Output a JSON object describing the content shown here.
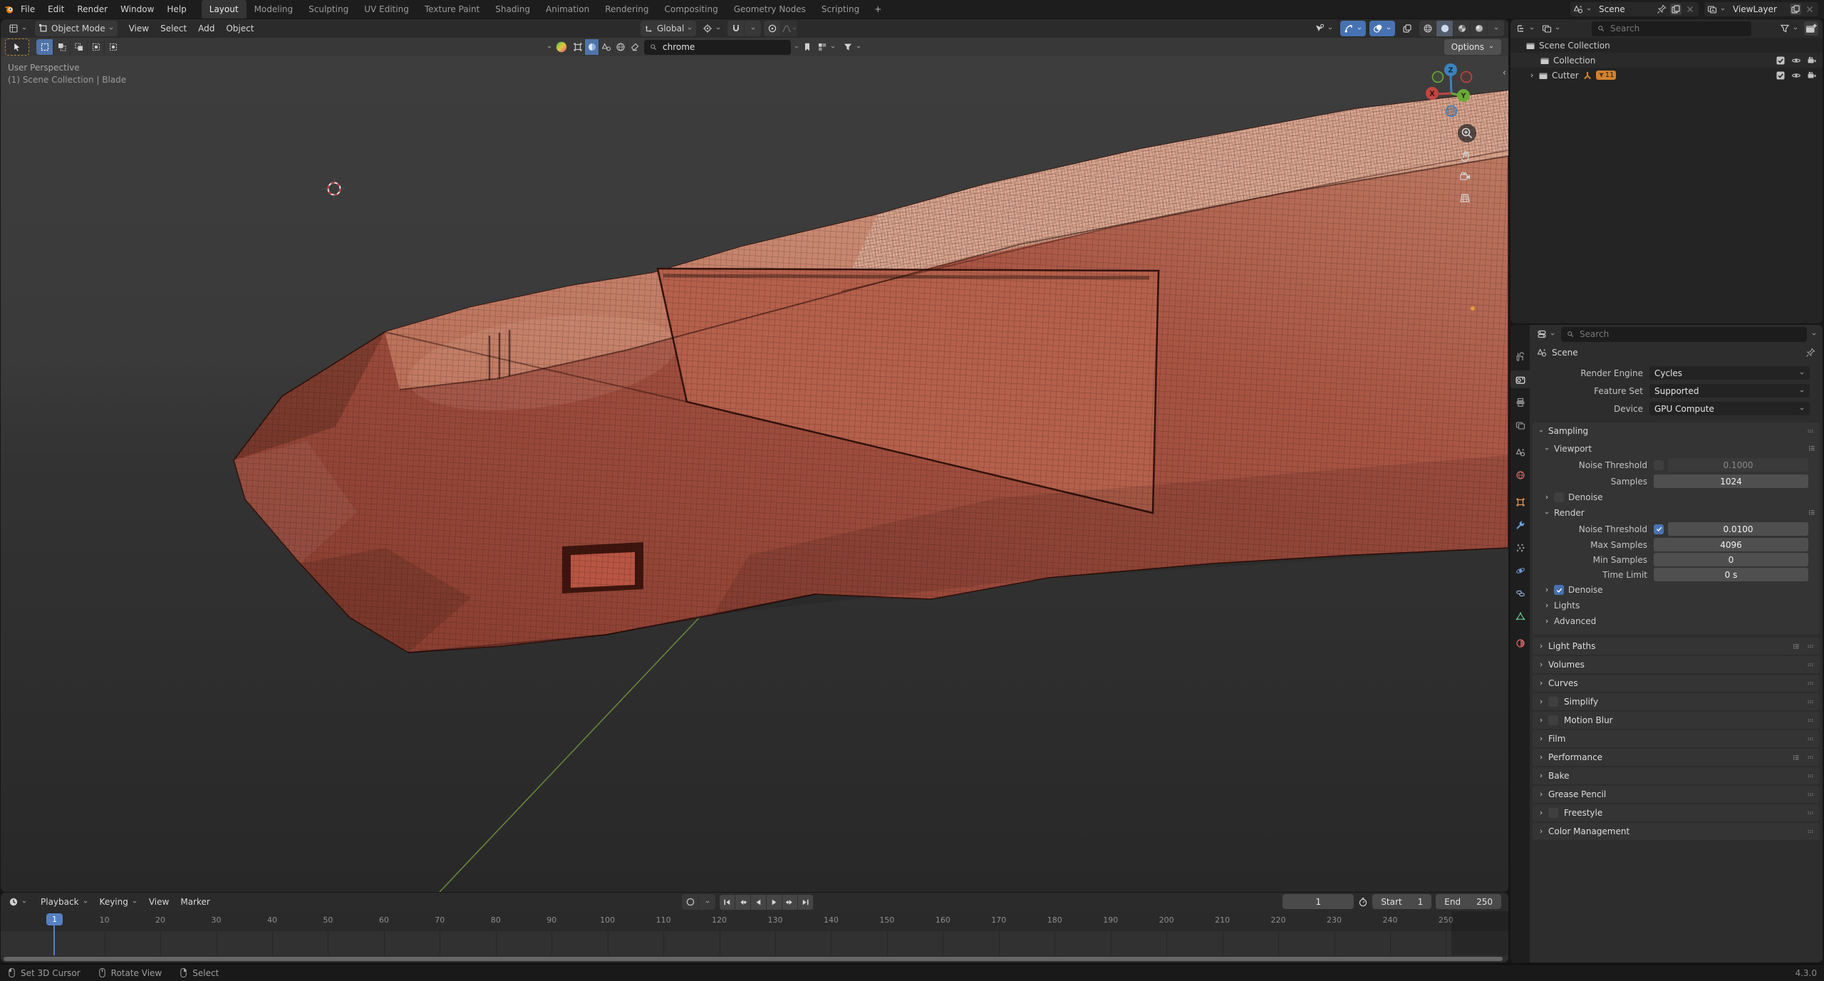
{
  "app": {
    "version": "4.3.0"
  },
  "topbar": {
    "menus": [
      "File",
      "Edit",
      "Render",
      "Window",
      "Help"
    ],
    "workspaces": [
      "Layout",
      "Modeling",
      "Sculpting",
      "UV Editing",
      "Texture Paint",
      "Shading",
      "Animation",
      "Rendering",
      "Compositing",
      "Geometry Nodes",
      "Scripting"
    ],
    "active_workspace": "Layout",
    "new_workspace_label": "+",
    "scene": {
      "value": "Scene"
    },
    "view_layer": {
      "value": "ViewLayer"
    }
  },
  "viewport": {
    "header": {
      "mode": "Object Mode",
      "menus": [
        "View",
        "Select",
        "Add",
        "Object"
      ],
      "orientation": "Global",
      "shading_active": "solid"
    },
    "tool_settings": {
      "search_value": "chrome",
      "options_label": "Options"
    },
    "overlay": {
      "line1": "User Perspective",
      "line2": "(1) Scene Collection | Blade"
    },
    "gizmo": {
      "x": "X",
      "y": "Y",
      "z": "Z"
    }
  },
  "outliner": {
    "search_placeholder": "Search",
    "rows": [
      {
        "label": "Scene Collection",
        "depth": 0,
        "expander": false,
        "toggles": false,
        "count": ""
      },
      {
        "label": "Collection",
        "depth": 1,
        "expander": false,
        "toggles": true,
        "count": ""
      },
      {
        "label": "Cutter",
        "depth": 1,
        "expander": true,
        "toggles": true,
        "count": "11"
      }
    ]
  },
  "properties": {
    "search_placeholder": "Search",
    "breadcrumb": "Scene",
    "tabs": [
      {
        "icon": "tool",
        "active": false,
        "group": 0
      },
      {
        "icon": "render",
        "active": true,
        "group": 0
      },
      {
        "icon": "output",
        "active": false,
        "group": 0
      },
      {
        "icon": "view-layer",
        "active": false,
        "group": 0
      },
      {
        "icon": "scene",
        "active": false,
        "group": 1
      },
      {
        "icon": "world",
        "active": false,
        "group": 0
      },
      {
        "icon": "object",
        "active": false,
        "group": 1
      },
      {
        "icon": "modifiers",
        "active": false,
        "group": 0
      },
      {
        "icon": "particles",
        "active": false,
        "group": 0
      },
      {
        "icon": "physics",
        "active": false,
        "group": 0
      },
      {
        "icon": "constraints",
        "active": false,
        "group": 0
      },
      {
        "icon": "object-data",
        "active": false,
        "group": 0
      },
      {
        "icon": "material",
        "active": false,
        "group": 1
      }
    ],
    "engine_fields": [
      {
        "label": "Render Engine",
        "value": "Cycles"
      },
      {
        "label": "Feature Set",
        "value": "Supported"
      },
      {
        "label": "Device",
        "value": "GPU Compute"
      }
    ],
    "sampling": {
      "title": "Sampling",
      "viewport": {
        "title": "Viewport",
        "noise_label": "Noise Threshold",
        "noise_value": "0.1000",
        "noise_enabled": false,
        "samples_label": "Samples",
        "samples_value": "1024",
        "denoise_label": "Denoise",
        "denoise_checked": false
      },
      "render": {
        "title": "Render",
        "noise_label": "Noise Threshold",
        "noise_value": "0.0100",
        "noise_enabled": true,
        "rows": [
          {
            "label": "Max Samples",
            "value": "4096"
          },
          {
            "label": "Min Samples",
            "value": "0"
          },
          {
            "label": "Time Limit",
            "value": "0 s"
          }
        ],
        "denoise_label": "Denoise",
        "denoise_checked": true
      },
      "extra_rows": [
        {
          "label": "Lights"
        },
        {
          "label": "Advanced"
        }
      ]
    },
    "panels": [
      {
        "title": "Light Paths",
        "menu": true,
        "checkbox": false
      },
      {
        "title": "Volumes",
        "menu": false,
        "checkbox": false
      },
      {
        "title": "Curves",
        "menu": false,
        "checkbox": false
      },
      {
        "title": "Simplify",
        "menu": false,
        "checkbox": true
      },
      {
        "title": "Motion Blur",
        "menu": false,
        "checkbox": true
      },
      {
        "title": "Film",
        "menu": false,
        "checkbox": false
      },
      {
        "title": "Performance",
        "menu": true,
        "checkbox": false
      },
      {
        "title": "Bake",
        "menu": false,
        "checkbox": false
      },
      {
        "title": "Grease Pencil",
        "menu": false,
        "checkbox": false
      },
      {
        "title": "Freestyle",
        "menu": false,
        "checkbox": true
      },
      {
        "title": "Color Management",
        "menu": false,
        "checkbox": false
      }
    ]
  },
  "timeline": {
    "menus": [
      {
        "label": "Playback",
        "caret": true
      },
      {
        "label": "Keying",
        "caret": true
      },
      {
        "label": "View",
        "caret": false
      },
      {
        "label": "Marker",
        "caret": false
      }
    ],
    "current_frame": "1",
    "start_label": "Start",
    "start_value": "1",
    "end_label": "End",
    "end_value": "250",
    "ruler_ticks": [
      10,
      20,
      30,
      40,
      50,
      60,
      70,
      80,
      90,
      100,
      110,
      120,
      130,
      140,
      150,
      160,
      170,
      180,
      190,
      200,
      210,
      220,
      230,
      240,
      250
    ],
    "playhead": {
      "frame": 1,
      "label": "1"
    }
  },
  "statusbar": {
    "hints": [
      {
        "button": "left",
        "label": "Set 3D Cursor"
      },
      {
        "button": "middle",
        "label": "Rotate View"
      },
      {
        "button": "right",
        "label": "Select"
      }
    ],
    "version": "4.3.0"
  },
  "colors": {
    "accent": "#4772b3",
    "axis_y_green": "#6e8f3c",
    "object_orange": "#e8983f",
    "selection_red": "#b04a3a"
  }
}
